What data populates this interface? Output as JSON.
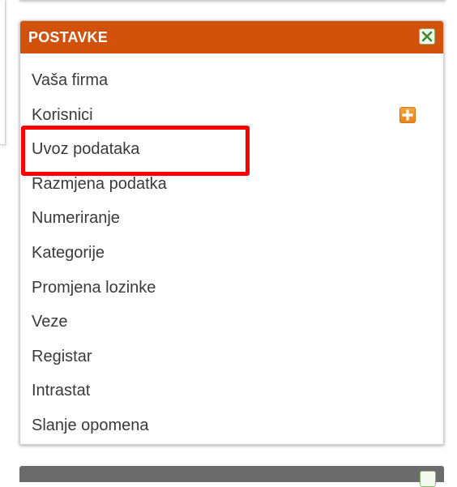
{
  "panel": {
    "title": "POSTAVKE",
    "header_color": "#d3520b",
    "close_icon": "close-x-icon"
  },
  "menu": {
    "items": [
      {
        "label": "Vaša firma"
      },
      {
        "label": "Korisnici",
        "action_icon": "plus-icon"
      },
      {
        "label": "Uvoz podataka",
        "highlighted": true
      },
      {
        "label": "Razmjena podatka"
      },
      {
        "label": "Numeriranje"
      },
      {
        "label": "Kategorije"
      },
      {
        "label": "Promjena lozinke"
      },
      {
        "label": "Veze"
      },
      {
        "label": "Registar"
      },
      {
        "label": "Intrastat"
      },
      {
        "label": "Slanje opomena"
      }
    ]
  },
  "highlight_color": "#ff0000"
}
